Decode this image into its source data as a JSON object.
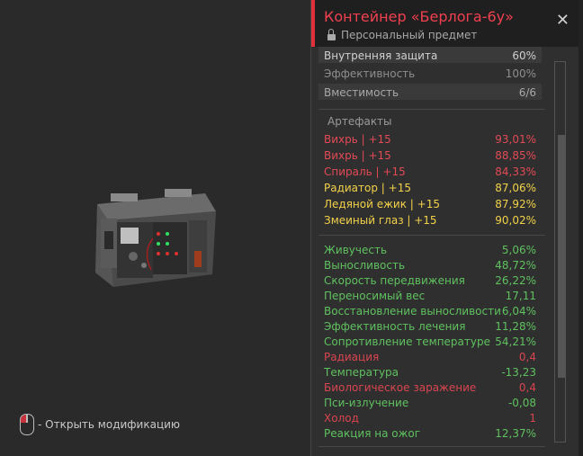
{
  "item": {
    "title": "Контейнер «Берлога-6у»",
    "subtitle": "Персональный предмет",
    "close_glyph": "✕"
  },
  "hint": {
    "label": "- Открыть модификацию"
  },
  "top_stats": [
    {
      "label": "Внутренняя защита",
      "value": "60%"
    },
    {
      "label": "Эффективность",
      "value": "100%"
    },
    {
      "label": "Вместимость",
      "value": "6/6"
    }
  ],
  "artifacts": {
    "title": "Артефакты",
    "items": [
      {
        "label": "Вихрь | +15",
        "value": "93,01%",
        "color": "#e24a55"
      },
      {
        "label": "Вихрь | +15",
        "value": "88,85%",
        "color": "#e24a55"
      },
      {
        "label": "Спираль | +15",
        "value": "84,33%",
        "color": "#e24a55"
      },
      {
        "label": "Радиатор | +15",
        "value": "87,06%",
        "color": "#f2d24a"
      },
      {
        "label": "Ледяной ежик | +15",
        "value": "87,92%",
        "color": "#f2d24a"
      },
      {
        "label": "Змеиный глаз | +15",
        "value": "90,02%",
        "color": "#f2d24a"
      }
    ]
  },
  "effects": [
    {
      "label": "Живучесть",
      "value": "5,06%",
      "color": "#5fc15f"
    },
    {
      "label": "Выносливость",
      "value": "48,72%",
      "color": "#5fc15f"
    },
    {
      "label": "Скорость передвижения",
      "value": "26,22%",
      "color": "#5fc15f"
    },
    {
      "label": "Переносимый вес",
      "value": "17,11",
      "color": "#5fc15f"
    },
    {
      "label": "Восстановление выносливости",
      "value": "6,04%",
      "color": "#5fc15f"
    },
    {
      "label": "Эффективность лечения",
      "value": "11,28%",
      "color": "#5fc15f"
    },
    {
      "label": "Сопротивление температуре",
      "value": "54,21%",
      "color": "#5fc15f"
    },
    {
      "label": "Радиация",
      "value": "0,4",
      "color": "#d9454f"
    },
    {
      "label": "Температура",
      "value": "-13,23",
      "color": "#5fc15f"
    },
    {
      "label": "Биологическое заражение",
      "value": "0,4",
      "color": "#d9454f"
    },
    {
      "label": "Пси-излучение",
      "value": "-0,08",
      "color": "#5fc15f"
    },
    {
      "label": "Холод",
      "value": "1",
      "color": "#d9454f"
    },
    {
      "label": "Реакция на ожог",
      "value": "12,37%",
      "color": "#5fc15f"
    }
  ]
}
